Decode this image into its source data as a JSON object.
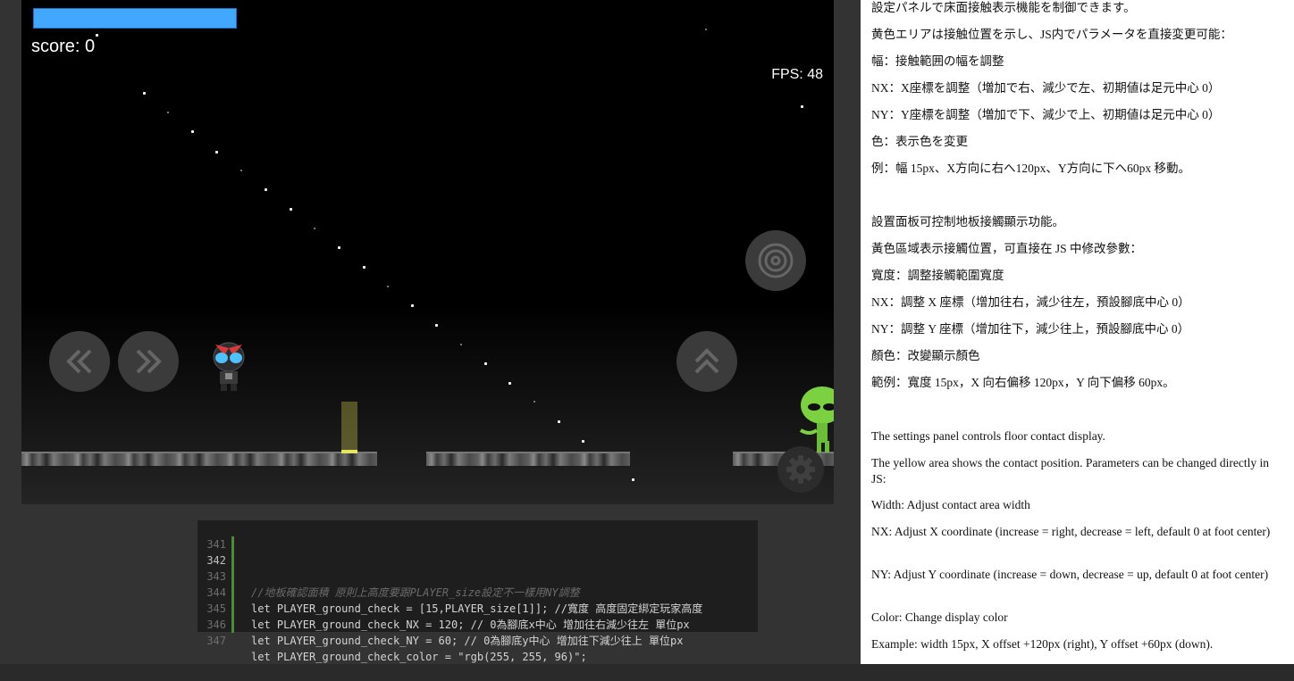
{
  "game": {
    "score_text": "score: 0",
    "fps_text": "FPS: 48",
    "health_fraction": 1.0,
    "colors": {
      "health": "#41a7ff",
      "ground_check": "rgb(255, 255, 96)"
    },
    "controls": {
      "left_icon": "double-chevron-left-icon",
      "right_icon": "double-chevron-right-icon",
      "jump_icon": "double-chevron-up-icon",
      "shoot_icon": "target-icon",
      "settings_icon": "gear-icon"
    }
  },
  "code": {
    "lines": [
      {
        "number": "341",
        "content": ""
      },
      {
        "number": "342",
        "content": "//地板確認面積 原則上高度要跟PLAYER_size設定不一樣用NY調整"
      },
      {
        "number": "343",
        "content": "let PLAYER_ground_check = [15,PLAYER_size[1]]; //寬度 高度固定綁定玩家高度"
      },
      {
        "number": "344",
        "content": "let PLAYER_ground_check_NX = 120; // 0為腳底x中心 增加往右減少往左 單位px"
      },
      {
        "number": "345",
        "content": "let PLAYER_ground_check_NY = 60; // 0為腳底y中心 增加往下減少往上 單位px"
      },
      {
        "number": "346",
        "content": "let PLAYER_ground_check_color = \"rgb(255, 255, 96)\";"
      },
      {
        "number": "347",
        "content": ""
      }
    ]
  },
  "doc": {
    "ja": {
      "intro": "設定パネルで床面接触表示機能を制御できます。",
      "desc": "黄色エリアは接触位置を示し、JS内でパラメータを直接変更可能：",
      "width": "幅：接触範囲の幅を調整",
      "nx": "NX：X座標を調整（増加で右、減少で左、初期値は足元中心 0）",
      "ny": "NY：Y座標を調整（増加で下、減少で上、初期値は足元中心 0）",
      "color": "色：表示色を変更",
      "example": "例：幅 15px、X方向に右へ120px、Y方向に下へ60px 移動。"
    },
    "zh": {
      "intro": "設置面板可控制地板接觸顯示功能。",
      "desc": "黃色區域表示接觸位置，可直接在 JS 中修改參數：",
      "width": "寬度：調整接觸範圍寬度",
      "nx": "NX：調整 X 座標（增加往右，減少往左，預設腳底中心 0）",
      "ny": "NY：調整 Y 座標（增加往下，減少往上，預設腳底中心 0）",
      "color": "顏色：改變顯示顏色",
      "example": "範例：寬度 15px，X 向右偏移 120px，Y 向下偏移 60px。"
    },
    "en": {
      "intro": "The settings panel controls floor contact display.",
      "desc": "The yellow area shows the contact position. Parameters can be changed directly in JS:",
      "width": "Width: Adjust contact area width",
      "nx": "NX: Adjust X coordinate (increase = right, decrease = left, default 0 at foot center)",
      "ny": "NY: Adjust Y coordinate (increase = down, decrease = up, default 0 at foot center)",
      "color": "Color: Change display color",
      "example": "Example: width 15px, X offset +120px (right), Y offset +60px (down)."
    }
  }
}
